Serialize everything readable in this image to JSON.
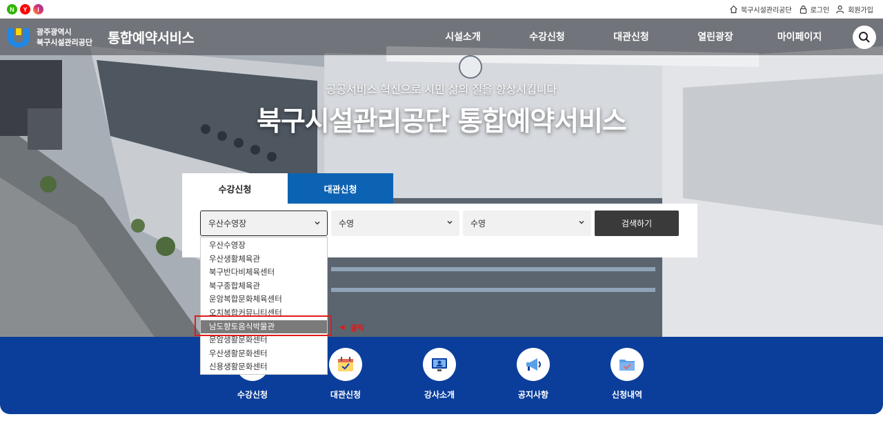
{
  "social": [
    "N",
    "Y",
    "I"
  ],
  "util_links": {
    "org_home": "북구시설관리공단",
    "login": "로그인",
    "signup": "회원가입"
  },
  "logo": {
    "line1": "광주광역시",
    "line2": "북구시설관리공단"
  },
  "service_title": "통합예약서비스",
  "nav": [
    "시설소개",
    "수강신청",
    "대관신청",
    "열린광장",
    "마이페이지"
  ],
  "hero": {
    "subtitle": "공공서비스 혁신으로 시민 삶의 질을 향상시킵니다",
    "title": "북구시설관리공단 통합예약서비스"
  },
  "tabs": {
    "active": "수강신청",
    "inactive": "대관신청"
  },
  "search": {
    "facility_value": "우산수영장",
    "category_value": "수영",
    "program_value": "수영",
    "submit_label": "검색하기"
  },
  "dropdown_options": [
    "우산수영장",
    "우산생활체육관",
    "북구반다비체육센터",
    "북구종합체육관",
    "운암복합문화체육센터",
    "오치복합커뮤니티센터",
    "남도향토음식박물관",
    "문암생활문화센터",
    "우산생활문화센터",
    "신용생활문화센터"
  ],
  "annotation": {
    "arrow": "◀",
    "label": "클릭"
  },
  "quick_menu": [
    "수강신청",
    "대관신청",
    "강사소개",
    "공지사항",
    "신청내역"
  ],
  "colors": {
    "primary_blue": "#0b3e9b",
    "tab_blue": "#0d63b3",
    "highlight_red": "#e01b1b",
    "search_button": "#3a3a3a"
  }
}
